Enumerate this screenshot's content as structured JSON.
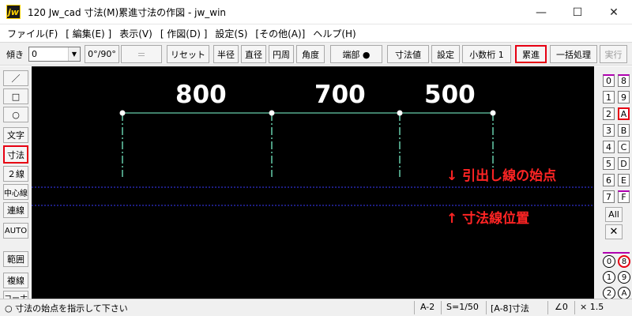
{
  "window": {
    "icon_text": "jw",
    "title": "120 Jw_cad 寸法(M)累進寸法の作図 - jw_win",
    "minimize": "—",
    "maximize": "☐",
    "close": "✕"
  },
  "menu": [
    "ファイル(F)",
    "[ 編集(E) ]",
    "表示(V)",
    "[ 作図(D) ]",
    "設定(S)",
    "[その他(A)]",
    "ヘルプ(H)"
  ],
  "toolbar": {
    "tilt_label": "傾き",
    "tilt_value": "0",
    "angle_btn": "0°/90°",
    "equal_btn": "＝",
    "reset_btn": "リセット",
    "radius_btn": "半径",
    "diameter_btn": "直径",
    "circumference_btn": "円周",
    "angle_dim_btn": "角度",
    "endpoint_btn": "端部 ●",
    "dim_value_btn": "寸法値",
    "settings_btn": "設定",
    "decimal_btn": "小数桁 1",
    "cumulative_btn": "累進",
    "batch_btn": "一括処理",
    "execute_btn": "実行"
  },
  "left_tools": [
    "／",
    "□",
    "○",
    "文字",
    "寸法",
    "２線",
    "中心線",
    "連線",
    "AUTO",
    "範囲",
    "複線",
    "コーナー"
  ],
  "canvas": {
    "dimensions": [
      "800",
      "700",
      "500"
    ],
    "annotation_start": "↓ 引出し線の始点",
    "annotation_dimline": "↑ 寸法線位置"
  },
  "layers": {
    "left_col": [
      "0",
      "1",
      "2",
      "3",
      "4",
      "5",
      "6",
      "7"
    ],
    "right_col": [
      "8",
      "9",
      "A",
      "B",
      "C",
      "D",
      "E",
      "F"
    ],
    "all_label": "All",
    "x_label": "✕",
    "circle_rows": [
      [
        "0",
        "8"
      ],
      [
        "1",
        "9"
      ],
      [
        "2",
        "A"
      ]
    ]
  },
  "status": {
    "message": "○ 寸法の始点を指示して下さい",
    "paper": "A-2",
    "scale": "S=1/50",
    "layer": "[A-8]寸法",
    "angle": "∠0",
    "zoom": "× 1.5"
  },
  "colors": {
    "canvas_bg": "#000000",
    "dim_line": "#7fffd4",
    "guide_line": "#3a3aff",
    "highlight": "#e60012",
    "annotation": "#ff2424"
  }
}
